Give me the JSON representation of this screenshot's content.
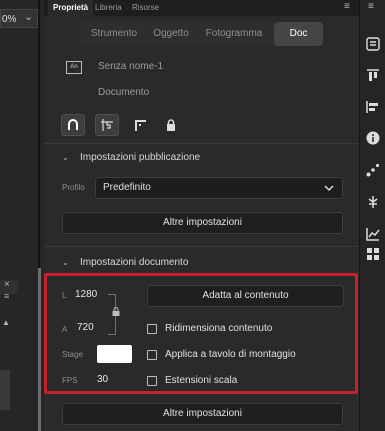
{
  "left": {
    "zoom_value": "0%"
  },
  "panel_tabs": [
    "Proprietà",
    "Libreria",
    "Risorse"
  ],
  "segments": [
    "Strumento",
    "Oggetto",
    "Fotogramma",
    "Doc"
  ],
  "document": {
    "icon_text": "An",
    "name": "Senza nome-1",
    "type": "Documento"
  },
  "publish": {
    "title": "Impostazioni pubblicazione",
    "profile_label": "Profilo",
    "profile_value": "Predefinito",
    "more_button": "Altre impostazioni"
  },
  "doc_settings": {
    "title": "Impostazioni documento",
    "width_label": "L",
    "width_value": "1280",
    "height_label": "A",
    "height_value": "720",
    "stage_label": "Stage",
    "stage_color": "#ffffff",
    "fps_label": "FPS",
    "fps_value": "30",
    "fit_button": "Adatta al contenuto",
    "checkbox_resize": "Ridimensiona contenuto",
    "checkbox_apply": "Applica a tavolo di montaggio",
    "checkbox_scale": "Estensioni scala",
    "more_button": "Altre impostazioni"
  },
  "colors": {
    "highlight": "#c8202a",
    "panel_bg": "#2a2a2a",
    "accent_white": "#ffffff"
  },
  "right_toolbar_icons": [
    "properties-icon",
    "align-top-icon",
    "align-left-icon",
    "align-distribute-icon",
    "info-icon",
    "motion-path-icon",
    "components-icon",
    "chart-icon",
    "grid-icon"
  ]
}
